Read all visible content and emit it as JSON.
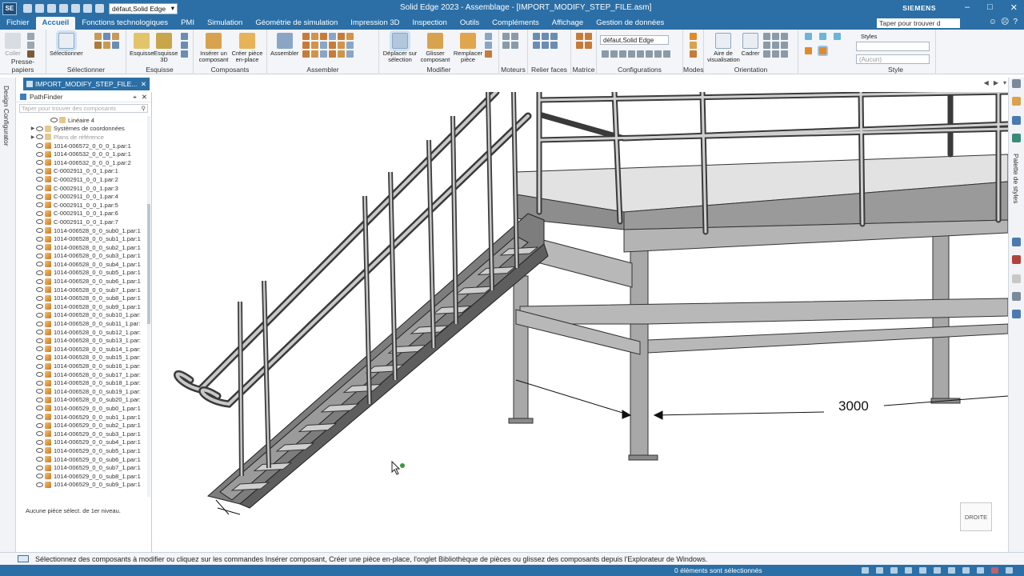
{
  "app": {
    "logo": "SE",
    "title": "Solid Edge 2023 - Assemblage - [IMPORT_MODIFY_STEP_FILE.asm]",
    "brand": "SIEMENS",
    "doc_style_select": "défaut,Solid Edge"
  },
  "menu": {
    "tabs": [
      "Fichier",
      "Accueil",
      "Fonctions technologiques",
      "PMI",
      "Simulation",
      "Géométrie de simulation",
      "Impression 3D",
      "Inspection",
      "Outils",
      "Compléments",
      "Affichage",
      "Gestion de données"
    ],
    "active_tab": "Accueil",
    "search_placeholder": "Taper pour trouver d"
  },
  "ribbon": {
    "clipboard": {
      "label": "Presse-papiers",
      "paste": "Coller"
    },
    "select": {
      "label": "Sélectionner",
      "button": "Sélectionner"
    },
    "sketch": {
      "label": "Esquisse",
      "sketch": "Esquisse",
      "sketch3d": "Esquisse 3D"
    },
    "components": {
      "label": "Composants",
      "insert": "Insérer un composant",
      "create_inplace": "Créer pièce en-place"
    },
    "assemble": {
      "label": "Assembler",
      "button": "Assembler"
    },
    "modify": {
      "label": "Modifier",
      "move": "Déplacer sur sélection",
      "drag": "Glisser composant",
      "replace": "Remplacer pièce"
    },
    "motors": {
      "label": "Moteurs"
    },
    "relate": {
      "label": "Relier faces"
    },
    "matrix": {
      "label": "Matrice"
    },
    "configurations": {
      "label": "Configurations",
      "select": "défaut,Solid Edge"
    },
    "modes": {
      "label": "Modes"
    },
    "orientation": {
      "label": "Orientation",
      "view_area": "Aire de visualisation",
      "fit": "Cadrer"
    },
    "style": {
      "label": "Style",
      "styles": "Styles",
      "none": "(Aucun)"
    }
  },
  "document_tab": {
    "name": "IMPORT_MODIFY_STEP_FILE..."
  },
  "left_panel": {
    "label": "Design Configurator"
  },
  "right_panel": {
    "label": "Palette de styles"
  },
  "pathfinder": {
    "title": "PathFinder",
    "search_placeholder": "Taper pour trouver des composants",
    "items": [
      {
        "label": "Linéaire 4",
        "kind": "sys",
        "indent": 3
      },
      {
        "label": "Systèmes de coordonnées",
        "kind": "sys",
        "indent": 1,
        "expandable": true
      },
      {
        "label": "Plans de référence",
        "kind": "sys",
        "indent": 1,
        "expandable": true,
        "dim": true
      },
      {
        "label": "1014-006572_0_0_0_1.par:1",
        "kind": "part",
        "indent": 1
      },
      {
        "label": "1014-006532_0_0_0_1.par:1",
        "kind": "part",
        "indent": 1
      },
      {
        "label": "1014-006532_0_0_0_1.par:2",
        "kind": "part",
        "indent": 1
      },
      {
        "label": "C-0002911_0_0_1.par:1",
        "kind": "part",
        "indent": 1
      },
      {
        "label": "C-0002911_0_0_1.par:2",
        "kind": "part",
        "indent": 1
      },
      {
        "label": "C-0002911_0_0_1.par:3",
        "kind": "part",
        "indent": 1
      },
      {
        "label": "C-0002911_0_0_1.par:4",
        "kind": "part",
        "indent": 1
      },
      {
        "label": "C-0002911_0_0_1.par:5",
        "kind": "part",
        "indent": 1
      },
      {
        "label": "C-0002911_0_0_1.par:6",
        "kind": "part",
        "indent": 1
      },
      {
        "label": "C-0002911_0_0_1.par:7",
        "kind": "part",
        "indent": 1
      },
      {
        "label": "1014-006528_0_0_sub0_1.par:1",
        "kind": "part",
        "indent": 1
      },
      {
        "label": "1014-006528_0_0_sub1_1.par:1",
        "kind": "part",
        "indent": 1
      },
      {
        "label": "1014-006528_0_0_sub2_1.par:1",
        "kind": "part",
        "indent": 1
      },
      {
        "label": "1014-006528_0_0_sub3_1.par:1",
        "kind": "part",
        "indent": 1
      },
      {
        "label": "1014-006528_0_0_sub4_1.par:1",
        "kind": "part",
        "indent": 1
      },
      {
        "label": "1014-006528_0_0_sub5_1.par:1",
        "kind": "part",
        "indent": 1
      },
      {
        "label": "1014-006528_0_0_sub6_1.par:1",
        "kind": "part",
        "indent": 1
      },
      {
        "label": "1014-006528_0_0_sub7_1.par:1",
        "kind": "part",
        "indent": 1
      },
      {
        "label": "1014-006528_0_0_sub8_1.par:1",
        "kind": "part",
        "indent": 1
      },
      {
        "label": "1014-006528_0_0_sub9_1.par:1",
        "kind": "part",
        "indent": 1
      },
      {
        "label": "1014-006528_0_0_sub10_1.par:",
        "kind": "part",
        "indent": 1
      },
      {
        "label": "1014-006528_0_0_sub11_1.par:",
        "kind": "part",
        "indent": 1
      },
      {
        "label": "1014-006528_0_0_sub12_1.par:",
        "kind": "part",
        "indent": 1
      },
      {
        "label": "1014-006528_0_0_sub13_1.par:",
        "kind": "part",
        "indent": 1
      },
      {
        "label": "1014-006528_0_0_sub14_1.par:",
        "kind": "part",
        "indent": 1
      },
      {
        "label": "1014-006528_0_0_sub15_1.par:",
        "kind": "part",
        "indent": 1
      },
      {
        "label": "1014-006528_0_0_sub16_1.par:",
        "kind": "part",
        "indent": 1
      },
      {
        "label": "1014-006528_0_0_sub17_1.par:",
        "kind": "part",
        "indent": 1
      },
      {
        "label": "1014-006528_0_0_sub18_1.par:",
        "kind": "part",
        "indent": 1
      },
      {
        "label": "1014-006528_0_0_sub19_1.par:",
        "kind": "part",
        "indent": 1
      },
      {
        "label": "1014-006528_0_0_sub20_1.par:",
        "kind": "part",
        "indent": 1
      },
      {
        "label": "1014-006529_0_0_sub0_1.par:1",
        "kind": "part",
        "indent": 1
      },
      {
        "label": "1014-006529_0_0_sub1_1.par:1",
        "kind": "part",
        "indent": 1
      },
      {
        "label": "1014-006529_0_0_sub2_1.par:1",
        "kind": "part",
        "indent": 1
      },
      {
        "label": "1014-006529_0_0_sub3_1.par:1",
        "kind": "part",
        "indent": 1
      },
      {
        "label": "1014-006529_0_0_sub4_1.par:1",
        "kind": "part",
        "indent": 1
      },
      {
        "label": "1014-006529_0_0_sub5_1.par:1",
        "kind": "part",
        "indent": 1
      },
      {
        "label": "1014-006529_0_0_sub6_1.par:1",
        "kind": "part",
        "indent": 1
      },
      {
        "label": "1014-006529_0_0_sub7_1.par:1",
        "kind": "part",
        "indent": 1
      },
      {
        "label": "1014-006529_0_0_sub8_1.par:1",
        "kind": "part",
        "indent": 1
      },
      {
        "label": "1014-006529_0_0_sub9_1.par:1",
        "kind": "part",
        "indent": 1
      }
    ],
    "message": "Aucune pièce sélect. de 1er niveau."
  },
  "viewport": {
    "dimension_value": "3000",
    "view_cube_label": "DROITE"
  },
  "status": {
    "prompt": "Sélectionnez des composants à modifier ou cliquez sur les commandes Insérer composant, Créer une pièce en-place, l'onglet Bibliothèque de pièces ou glissez des composants depuis l'Explorateur de Windows.",
    "selection_count": "0 éléments sont sélectionnés"
  },
  "colors": {
    "accent": "#2b6fa6",
    "steel": "#8a8a8a",
    "part_icon": "#e0a050"
  }
}
